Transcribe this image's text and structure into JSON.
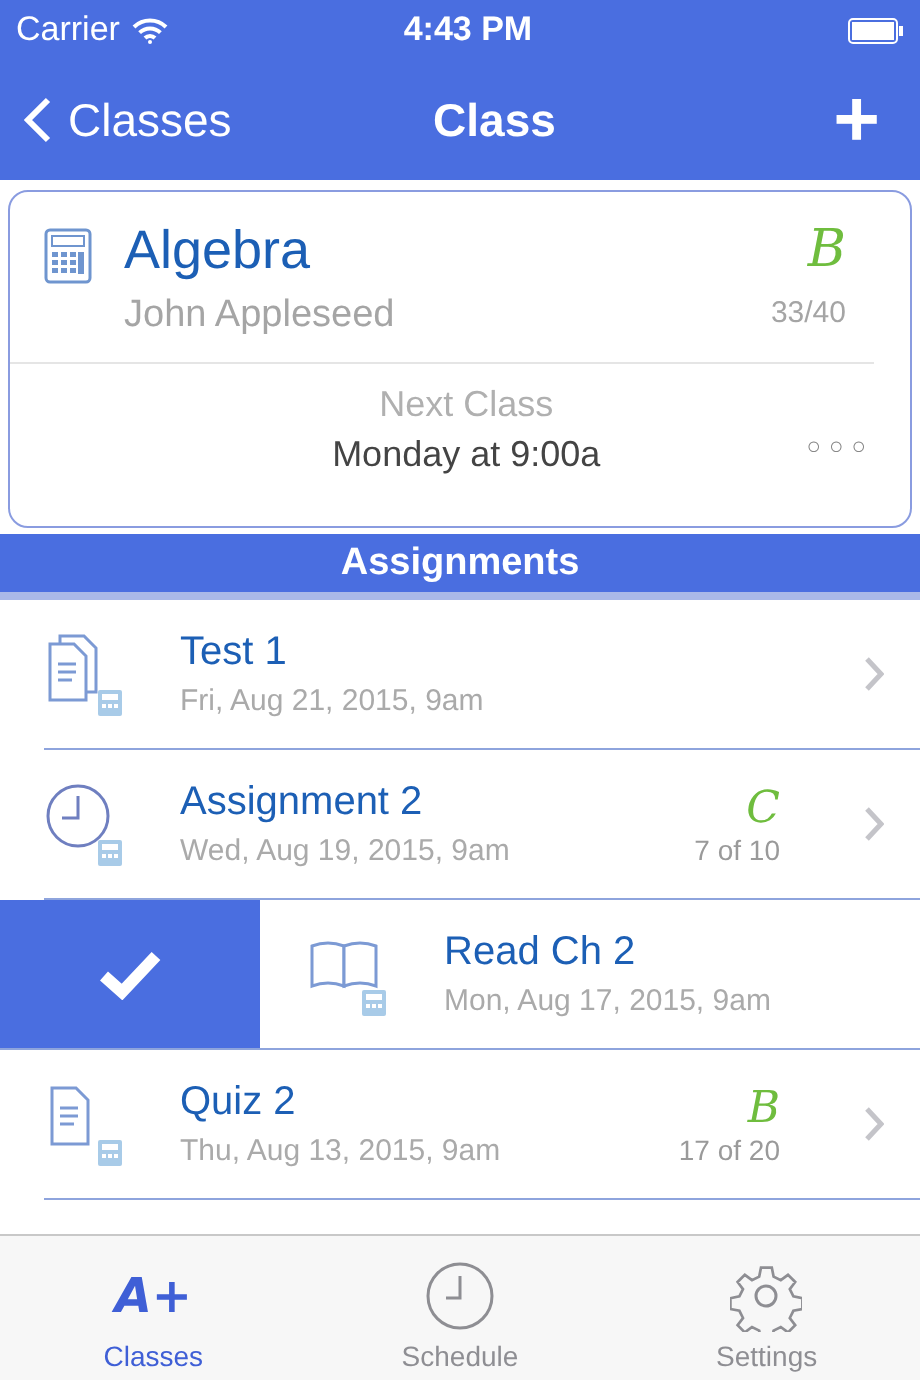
{
  "status_bar": {
    "carrier": "Carrier",
    "time": "4:43 PM"
  },
  "nav": {
    "back": "Classes",
    "title": "Class",
    "add": "+"
  },
  "class_card": {
    "name": "Algebra",
    "teacher": "John Appleseed",
    "grade": "B",
    "score": "33/40",
    "next_label": "Next Class",
    "next_time": "Monday at 9:00a",
    "more": "○○○"
  },
  "section": {
    "title": "Assignments"
  },
  "assignments": [
    {
      "kind": "test",
      "title": "Test 1",
      "date": "Fri, Aug 21, 2015, 9am",
      "swiped": false
    },
    {
      "kind": "assignment",
      "title": "Assignment 2",
      "date": "Wed, Aug 19, 2015, 9am",
      "grade": "C",
      "score": "7 of 10",
      "swiped": false
    },
    {
      "kind": "reading",
      "title": "Read Ch 2",
      "date": "Mon, Aug 17, 2015, 9am",
      "swiped": true
    },
    {
      "kind": "quiz",
      "title": "Quiz 2",
      "date": "Thu, Aug 13, 2015, 9am",
      "grade": "B",
      "score": "17 of 20",
      "swiped": false
    }
  ],
  "tabs": [
    {
      "kind": "text",
      "icon_text": "A+",
      "label": "Classes",
      "selected": true
    },
    {
      "kind": "clock",
      "label": "Schedule",
      "selected": false
    },
    {
      "kind": "gear",
      "label": "Settings",
      "selected": false
    }
  ]
}
